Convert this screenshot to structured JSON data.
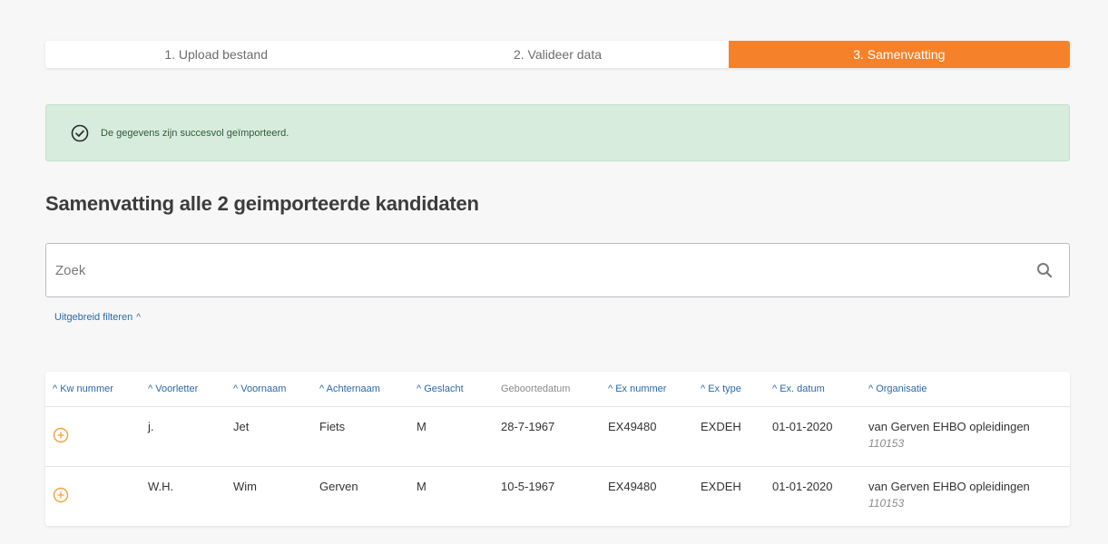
{
  "stepper": {
    "steps": [
      {
        "label": "1. Upload bestand"
      },
      {
        "label": "2. Valideer data"
      },
      {
        "label": "3. Samenvatting"
      }
    ]
  },
  "alert": {
    "message": "De gegevens zijn succesvol geïmporteerd.",
    "icon": "check-circle-icon",
    "color": "#d8ecdd"
  },
  "title": "Samenvatting alle 2 geimporteerde kandidaten",
  "search": {
    "placeholder": "Zoek",
    "value": ""
  },
  "filter": {
    "label": "Uitgebreid filteren",
    "chevron": "^"
  },
  "table": {
    "columns": [
      "^ Kw nummer",
      "^ Voorletter",
      "^ Voornaam",
      "^ Achternaam",
      "^ Geslacht",
      "Geboortedatum",
      "^ Ex nummer",
      "^ Ex type",
      "^ Ex. datum",
      "^ Organisatie"
    ],
    "rows": [
      {
        "voorletter": "j.",
        "voornaam": "Jet",
        "achternaam": "Fiets",
        "geslacht": "M",
        "geboortedatum": "28-7-1967",
        "ex_nummer": "EX49480",
        "ex_type": "EXDEH",
        "ex_datum": "01-01-2020",
        "organisatie": "van Gerven EHBO opleidingen",
        "organisatie_id": "110153"
      },
      {
        "voorletter": "W.H.",
        "voornaam": "Wim",
        "achternaam": "Gerven",
        "geslacht": "M",
        "geboortedatum": "10-5-1967",
        "ex_nummer": "EX49480",
        "ex_type": "EXDEH",
        "ex_datum": "01-01-2020",
        "organisatie": "van Gerven EHBO opleidingen",
        "organisatie_id": "110153"
      }
    ]
  },
  "colors": {
    "accent": "#f5822a",
    "link": "#2a6aa6",
    "success_bg": "#d8ecdd"
  }
}
